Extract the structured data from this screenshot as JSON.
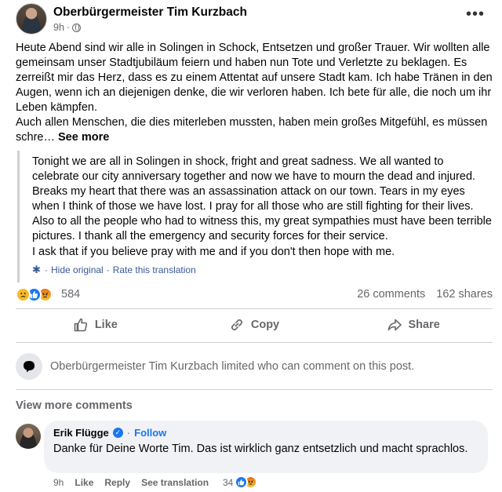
{
  "post": {
    "author": "Oberbürgermeister Tim Kurzbach",
    "time": "9h",
    "visibility_icon": "globe-icon",
    "more_icon": "more-options-icon",
    "body_paragraphs": [
      "Heute Abend sind wir alle in Solingen in Schock, Entsetzen und großer Trauer. Wir wollten alle gemeinsam unser Stadtjubiläum feiern und haben nun Tote und Verletzte zu beklagen. Es zerreißt mir das Herz, dass es zu einem Attentat auf unsere Stadt kam. Ich habe Tränen in den Augen, wenn ich an diejenigen denke, die wir verloren haben. Ich bete für alle, die noch um ihr Leben kämpfen.",
      "Auch allen Menschen, die dies miterleben mussten, haben mein großes Mitgefühl, es müssen schre…"
    ],
    "see_more": "See more",
    "translation": {
      "paragraphs": [
        "Tonight we are all in Solingen in shock, fright and great sadness. We all wanted to celebrate our city anniversary together and now we have to mourn the dead and injured. Breaks my heart that there was an assassination attack on our town. Tears in my eyes when I think of those we have lost. I pray for all those who are still fighting for their lives.",
        "Also to all the people who had to witness this, my great sympathies must have been terrible pictures. I thank all the emergency and security forces for their service.",
        "I ask that if you believe pray with me and if you don't then hope with me."
      ],
      "hide_original": "Hide original",
      "separator": "·",
      "rate": "Rate this translation"
    },
    "reactions": {
      "types": [
        "sad",
        "like",
        "angry"
      ],
      "count": "584",
      "comments": "26 comments",
      "shares": "162 shares"
    },
    "actions": {
      "like": "Like",
      "copy": "Copy",
      "share": "Share"
    },
    "limited_comments": "Oberbürgermeister Tim Kurzbach limited who can comment on this post.",
    "view_more_comments": "View more comments"
  },
  "comment": {
    "author": "Erik Flügge",
    "verified": true,
    "follow_label": "Follow",
    "separator": "·",
    "text": "Danke für Deine Worte Tim. Das ist wirklich ganz entsetzlich und macht sprachlos.",
    "time": "9h",
    "like": "Like",
    "reply": "Reply",
    "see_translation": "See translation",
    "reaction_count": "34",
    "reaction_types": [
      "like",
      "angry"
    ]
  },
  "colors": {
    "link_blue": "#1877f2",
    "secondary_text": "#65676b",
    "bubble_bg": "#f0f2f5"
  }
}
